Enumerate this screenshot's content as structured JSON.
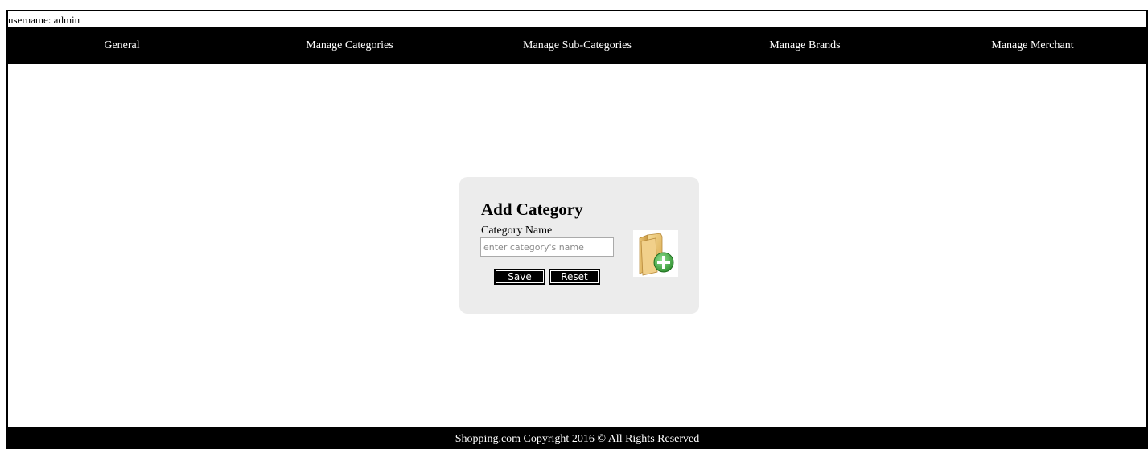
{
  "header": {
    "username_text": "username: admin"
  },
  "nav": {
    "items": [
      {
        "label": "General"
      },
      {
        "label": "Manage Categories"
      },
      {
        "label": "Manage Sub-Categories"
      },
      {
        "label": "Manage Brands"
      },
      {
        "label": "Manage Merchant"
      }
    ]
  },
  "form": {
    "title": "Add Category",
    "field_label": "Category Name",
    "input_value": "",
    "input_placeholder": "enter category's name",
    "save_label": "Save",
    "reset_label": "Reset",
    "icon": "folder-add-icon"
  },
  "footer": {
    "text": "Shopping.com Copyright 2016 © All Rights Reserved"
  },
  "colors": {
    "nav_bg": "#000000",
    "card_bg": "#ececec",
    "add_green": "#3aa13a"
  }
}
